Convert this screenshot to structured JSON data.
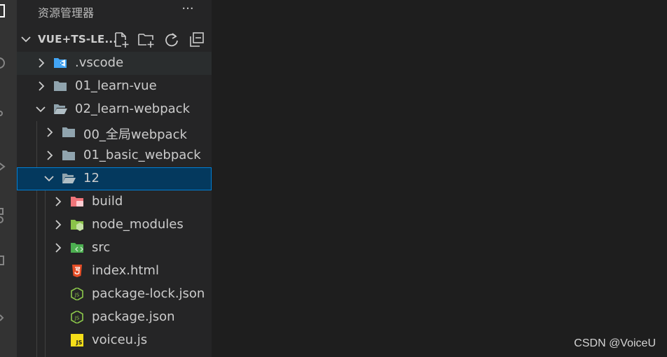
{
  "explorer": {
    "title": "资源管理器",
    "more": "···"
  },
  "workspace": {
    "title": "VUE+TS-LE..."
  },
  "tree": [
    {
      "label": ".vscode",
      "type": "folder",
      "icon": "vscode-folder-icon",
      "expanded": false
    },
    {
      "label": "01_learn-vue",
      "type": "folder",
      "icon": "folder-icon",
      "expanded": false
    },
    {
      "label": "02_learn-webpack",
      "type": "folder",
      "icon": "folder-open-icon",
      "expanded": true
    },
    {
      "label": "00_全局webpack",
      "type": "folder",
      "icon": "folder-icon",
      "expanded": false
    },
    {
      "label": "01_basic_webpack",
      "type": "folder",
      "icon": "folder-icon",
      "expanded": false
    },
    {
      "label": "12",
      "type": "folder",
      "icon": "folder-open-icon",
      "expanded": true
    },
    {
      "label": "build",
      "type": "folder",
      "icon": "build-folder-icon",
      "expanded": false
    },
    {
      "label": "node_modules",
      "type": "folder",
      "icon": "node-folder-icon",
      "expanded": false
    },
    {
      "label": "src",
      "type": "folder",
      "icon": "src-folder-icon",
      "expanded": false
    },
    {
      "label": "index.html",
      "type": "file",
      "icon": "html5-icon"
    },
    {
      "label": "package-lock.json",
      "type": "file",
      "icon": "nodejs-icon"
    },
    {
      "label": "package.json",
      "type": "file",
      "icon": "nodejs-icon"
    },
    {
      "label": "voiceu.js",
      "type": "file",
      "icon": "javascript-icon"
    }
  ],
  "watermark": "CSDN @VoiceU",
  "colors": {
    "selection": "#04395e",
    "selection_border": "#007fd4",
    "html": "#e44d26",
    "node": "#8cc84b",
    "js": "#f5de19",
    "build": "#f0757a",
    "src": "#4caf50"
  }
}
